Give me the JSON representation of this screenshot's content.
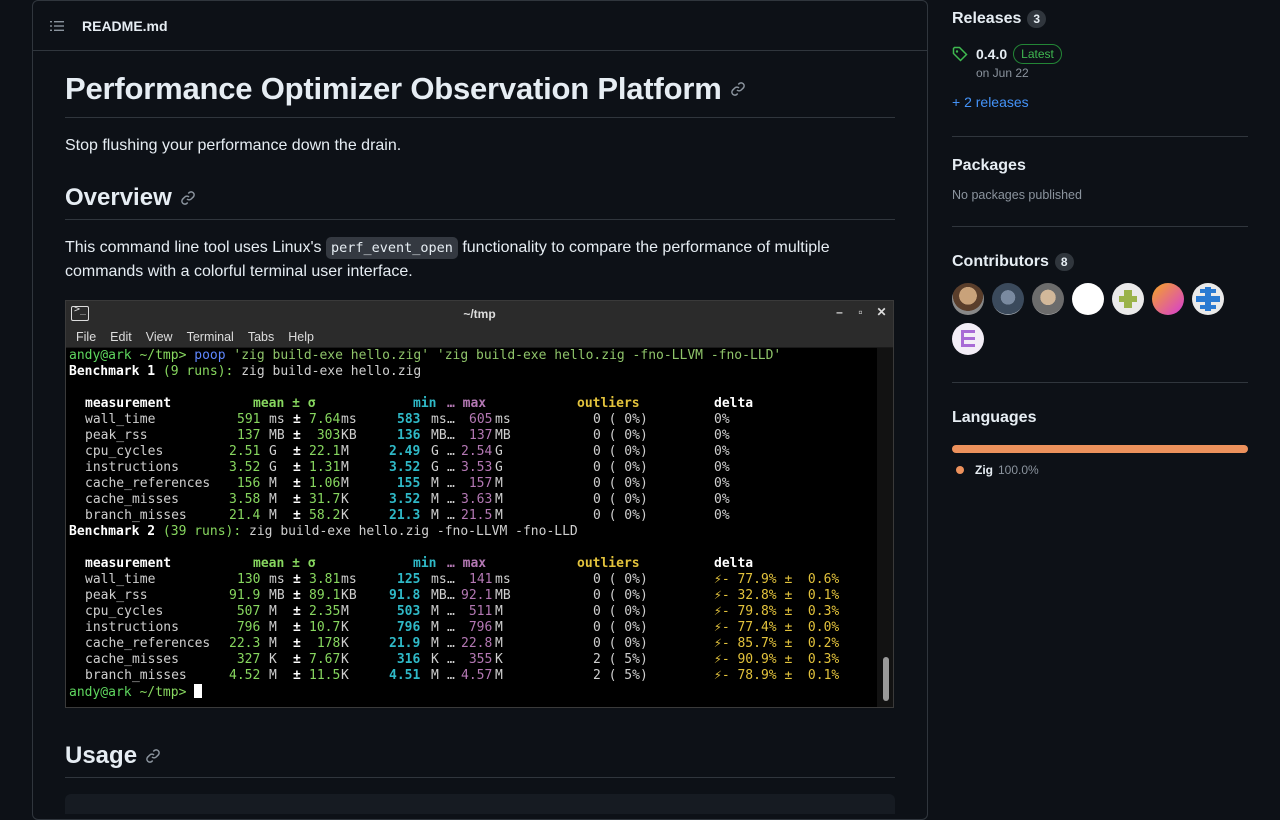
{
  "readme": {
    "filename": "README.md",
    "title": "Performance Optimizer Observation Platform",
    "tagline": "Stop flushing your performance down the drain.",
    "overview_heading": "Overview",
    "overview_p1": "This command line tool uses Linux's ",
    "overview_code": "perf_event_open",
    "overview_p2": " functionality to compare the performance of multiple",
    "overview_p3": "commands with a colorful terminal user interface.",
    "usage_heading": "Usage"
  },
  "terminal": {
    "title": "~/tmp",
    "menu": [
      "File",
      "Edit",
      "View",
      "Terminal",
      "Tabs",
      "Help"
    ],
    "prompt_user": "andy@ark",
    "prompt_dir": "~/tmp>",
    "command": "poop",
    "command_args": "'zig build-exe hello.zig' 'zig build-exe hello.zig -fno-LLVM -fno-LLD'",
    "headers": {
      "measurement": "measurement",
      "mean": "mean ± σ",
      "min": "min",
      "max": "… max",
      "outliers": "outliers",
      "delta": "delta"
    },
    "benchmarks": [
      {
        "label": "Benchmark 1",
        "runs": "(9 runs):",
        "cmd": "zig build-exe hello.zig",
        "rows": [
          {
            "m": "wall_time",
            "mean": "591",
            "mu": "ms",
            "sd": "7.64",
            "su": "ms",
            "min": "583",
            "minu": "ms",
            "max": "605",
            "maxu": "ms",
            "out": "0 ( 0%)",
            "delta": "0%"
          },
          {
            "m": "peak_rss",
            "mean": "137",
            "mu": "MB",
            "sd": " 303",
            "su": "KB",
            "min": "136",
            "minu": "MB",
            "max": "137",
            "maxu": "MB",
            "out": "0 ( 0%)",
            "delta": "0%"
          },
          {
            "m": "cpu_cycles",
            "mean": "2.51",
            "mu": "G",
            "sd": "22.1",
            "su": "M",
            "min": "2.49",
            "minu": "G",
            "max": "2.54",
            "maxu": "G",
            "out": "0 ( 0%)",
            "delta": "0%"
          },
          {
            "m": "instructions",
            "mean": "3.52",
            "mu": "G",
            "sd": "1.31",
            "su": "M",
            "min": "3.52",
            "minu": "G",
            "max": "3.53",
            "maxu": "G",
            "out": "0 ( 0%)",
            "delta": "0%"
          },
          {
            "m": "cache_references",
            "mean": " 156",
            "mu": "M",
            "sd": "1.06",
            "su": "M",
            "min": " 155",
            "minu": "M",
            "max": " 157",
            "maxu": "M",
            "out": "0 ( 0%)",
            "delta": "0%"
          },
          {
            "m": "cache_misses",
            "mean": "3.58",
            "mu": "M",
            "sd": "31.7",
            "su": "K",
            "min": "3.52",
            "minu": "M",
            "max": "3.63",
            "maxu": "M",
            "out": "0 ( 0%)",
            "delta": "0%"
          },
          {
            "m": "branch_misses",
            "mean": "21.4",
            "mu": "M",
            "sd": "58.2",
            "su": "K",
            "min": "21.3",
            "minu": "M",
            "max": "21.5",
            "maxu": "M",
            "out": "0 ( 0%)",
            "delta": "0%"
          }
        ]
      },
      {
        "label": "Benchmark 2",
        "runs": "(39 runs):",
        "cmd": "zig build-exe hello.zig -fno-LLVM -fno-LLD",
        "rows": [
          {
            "m": "wall_time",
            "mean": "130",
            "mu": "ms",
            "sd": "3.81",
            "su": "ms",
            "min": "125",
            "minu": "ms",
            "max": "141",
            "maxu": "ms",
            "out": "0 ( 0%)",
            "delta": "⚡- 77.9% ±  0.6%"
          },
          {
            "m": "peak_rss",
            "mean": "91.9",
            "mu": "MB",
            "sd": "89.1",
            "su": "KB",
            "min": "91.8",
            "minu": "MB",
            "max": "92.1",
            "maxu": "MB",
            "out": "0 ( 0%)",
            "delta": "⚡- 32.8% ±  0.1%"
          },
          {
            "m": "cpu_cycles",
            "mean": " 507",
            "mu": "M",
            "sd": "2.35",
            "su": "M",
            "min": " 503",
            "minu": "M",
            "max": " 511",
            "maxu": "M",
            "out": "0 ( 0%)",
            "delta": "⚡- 79.8% ±  0.3%"
          },
          {
            "m": "instructions",
            "mean": " 796",
            "mu": "M",
            "sd": "10.7",
            "su": "K",
            "min": " 796",
            "minu": "M",
            "max": " 796",
            "maxu": "M",
            "out": "0 ( 0%)",
            "delta": "⚡- 77.4% ±  0.0%"
          },
          {
            "m": "cache_references",
            "mean": "22.3",
            "mu": "M",
            "sd": " 178",
            "su": "K",
            "min": "21.9",
            "minu": "M",
            "max": "22.8",
            "maxu": "M",
            "out": "0 ( 0%)",
            "delta": "⚡- 85.7% ±  0.2%"
          },
          {
            "m": "cache_misses",
            "mean": " 327",
            "mu": "K",
            "sd": "7.67",
            "su": "K",
            "min": " 316",
            "minu": "K",
            "max": " 355",
            "maxu": "K",
            "out": "2 ( 5%)",
            "delta": "⚡- 90.9% ±  0.3%"
          },
          {
            "m": "branch_misses",
            "mean": "4.52",
            "mu": "M",
            "sd": "11.5",
            "su": "K",
            "min": "4.51",
            "minu": "M",
            "max": "4.57",
            "maxu": "M",
            "out": "2 ( 5%)",
            "delta": "⚡- 78.9% ±  0.1%"
          }
        ]
      }
    ]
  },
  "sidebar": {
    "releases": {
      "heading": "Releases",
      "count": "3",
      "version": "0.4.0",
      "latest_label": "Latest",
      "date": "on Jun 22",
      "more": "+ 2 releases"
    },
    "packages": {
      "heading": "Packages",
      "empty": "No packages published"
    },
    "contributors": {
      "heading": "Contributors",
      "count": "8"
    },
    "languages": {
      "heading": "Languages",
      "name": "Zig",
      "percent": "100.0%",
      "color": "#ec915c"
    }
  },
  "colors": {
    "accent_link": "#4493f8",
    "latest_green": "#3fb950",
    "zig": "#ec915c"
  }
}
